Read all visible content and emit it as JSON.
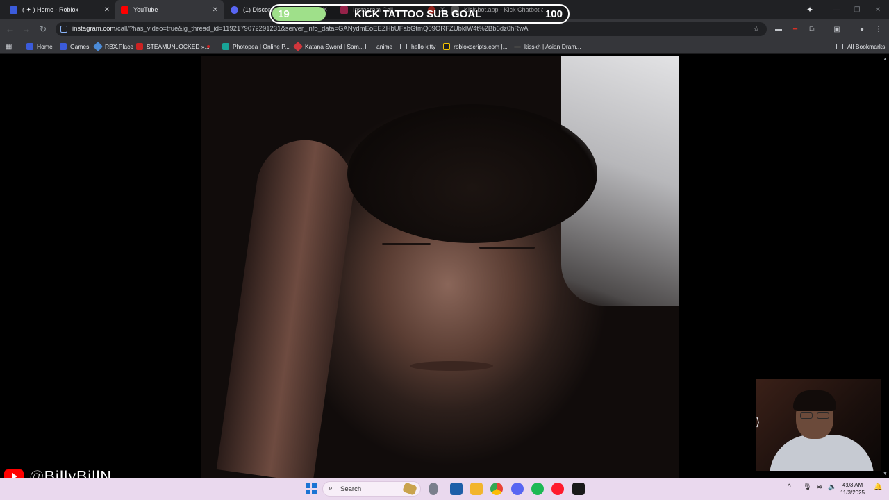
{
  "browser": {
    "tabs": [
      {
        "label": "( ✦ ) Home - Roblox",
        "favicon_color": "#3b5bdb"
      },
      {
        "label": "YouTube",
        "favicon_color": "#ff0000"
      },
      {
        "label": "(1) Discord |",
        "favicon_color": "#5865f2"
      },
      {
        "label": "Instagram Call",
        "favicon_color": "#e1306c"
      },
      {
        "label": "X",
        "favicon_color": "#d93025"
      },
      {
        "label": "Kick.bot.app - Kick Chatbot and",
        "favicon_color": "#777777"
      }
    ],
    "url_host": "instagram.com",
    "url_rest": "/call/?has_video=true&ig_thread_id=119217907229123​1&server_info_data=GANydmEoEEZHbUFabGtmQ09ORFZUbkIW4t%2Bb6dz0hRwA",
    "bookmarks": [
      {
        "label": "Home",
        "icon_color": "#3b5bdb"
      },
      {
        "label": "Games",
        "icon_color": "#3b5bdb"
      },
      {
        "label": "RBX.Place",
        "icon_color": "#4b8bd8"
      },
      {
        "label": "STEAMUNLOCKED »...",
        "icon_color": "#cc2222"
      },
      {
        "label": "",
        "icon_color": "#cc2222"
      },
      {
        "label": "Photopea | Online P...",
        "icon_color": "#18a497"
      },
      {
        "label": "Katana Sword | Sam...",
        "icon_color": "#d0363c"
      },
      {
        "label": "anime",
        "icon_color": "folder"
      },
      {
        "label": "hello kitty",
        "icon_color": "folder"
      },
      {
        "label": "robloxscripts.com |...",
        "icon_color": "#222222"
      },
      {
        "label": "kisskh | Asian Dram...",
        "icon_color": "#444444"
      }
    ],
    "all_bookmarks": "All Bookmarks"
  },
  "overlay": {
    "goal_title": "KICK TATTOO SUB GOAL",
    "current": "19",
    "target": "100",
    "progress_fraction": 0.19,
    "fill_color": "#9fe08a"
  },
  "stream_handle": "@BillyBillN",
  "taskbar": {
    "search_label": "Search",
    "time": "4:03 AM",
    "date": "11/3/2025"
  }
}
